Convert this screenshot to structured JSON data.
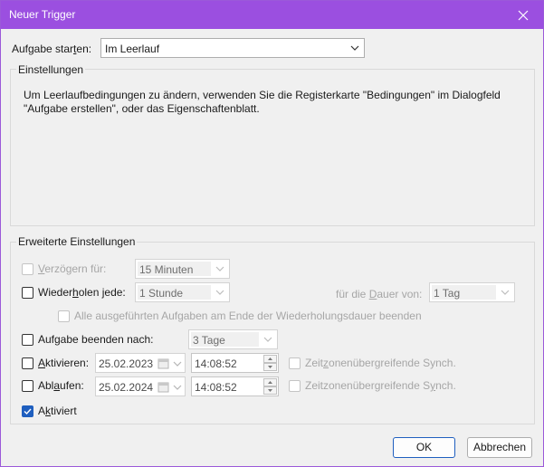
{
  "window": {
    "title": "Neuer Trigger",
    "accent_color": "#9b4fe0"
  },
  "start_task": {
    "label_pre": "Aufgabe star",
    "label_accel": "t",
    "label_post": "en:",
    "value": "Im Leerlauf"
  },
  "settings": {
    "title": "Einstellungen",
    "info_line1": "Um Leerlaufbedingungen zu ändern, verwenden Sie die Registerkarte \"Bedingungen\" im Dialogfeld",
    "info_line2": "\"Aufgabe erstellen\", oder das Eigenschaftenblatt."
  },
  "advanced": {
    "title": "Erweiterte Einstellungen",
    "delay": {
      "label_accel": "V",
      "label_rest": "erzögern für:",
      "value": "15 Minuten",
      "checked": false,
      "enabled": false
    },
    "repeat": {
      "label_pre": "Wieder",
      "label_accel": "h",
      "label_post": "olen jede:",
      "value": "1 Stunde",
      "checked": false,
      "duration_pre": "für die ",
      "duration_accel": "D",
      "duration_post": "auer von:",
      "duration_value": "1 Tag"
    },
    "stop_all": {
      "label": "Alle ausgeführten Aufgaben am Ende der Wiederholungsdauer beenden",
      "checked": false,
      "enabled": false
    },
    "stop_after": {
      "label_pre": "Aufgabe beenden nach:",
      "value": "3 Tage",
      "checked": false
    },
    "activate": {
      "label_accel": "A",
      "label_rest": "ktivieren:",
      "checked": false,
      "date": "25.02.2023",
      "time": "14:08:52",
      "sync_pre": "Zeit",
      "sync_accel": "z",
      "sync_post": "onenübergreifende Synch."
    },
    "expire": {
      "label_pre": "Abl",
      "label_accel": "a",
      "label_post": "ufen:",
      "checked": false,
      "date": "25.02.2024",
      "time": "14:08:52",
      "sync_pre": "Zeitzonenübergreifende S",
      "sync_accel": "y",
      "sync_post": "nch."
    },
    "enabled": {
      "label_accel": "k",
      "label_pre": "A",
      "label_post": "tiviert",
      "checked": true
    }
  },
  "buttons": {
    "ok": "OK",
    "cancel": "Abbrechen"
  }
}
